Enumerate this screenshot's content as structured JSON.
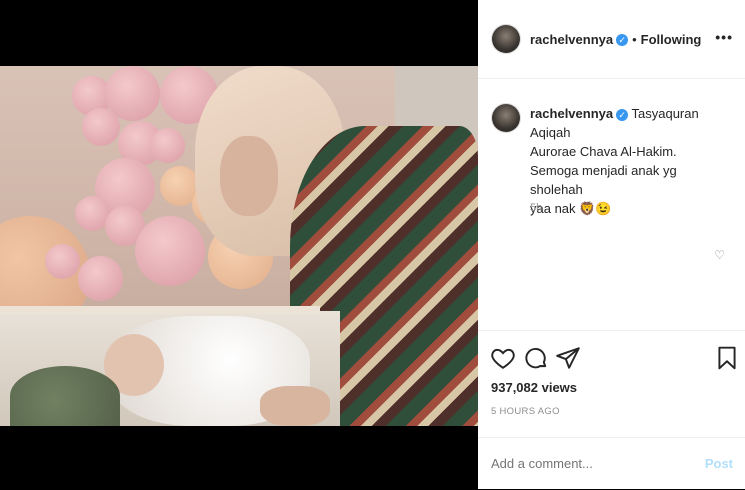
{
  "post": {
    "username": "rachelvennya",
    "verified_icon": "verified-badge-icon",
    "separator": "•",
    "follow_status": "Following",
    "more_label": "•••",
    "caption_lines": [
      "Tasyaquran Aqiqah",
      "Aurorae Chava Al-Hakim.",
      "Semoga menjadi anak yg sholehah",
      "yaa nak"
    ],
    "caption_emoji": "🦁😉",
    "caption_time": "5h",
    "views": "937,082 views",
    "posted_ago": "5 HOURS AGO",
    "comment_placeholder": "Add a comment...",
    "post_label": "Post"
  },
  "icons": {
    "like": "heart-icon",
    "comment": "comment-icon",
    "share": "share-icon",
    "save": "bookmark-icon"
  },
  "colors": {
    "verified": "#3897f0",
    "post_disabled": "#b2dffc",
    "secondary_text": "#8e8e8e"
  }
}
